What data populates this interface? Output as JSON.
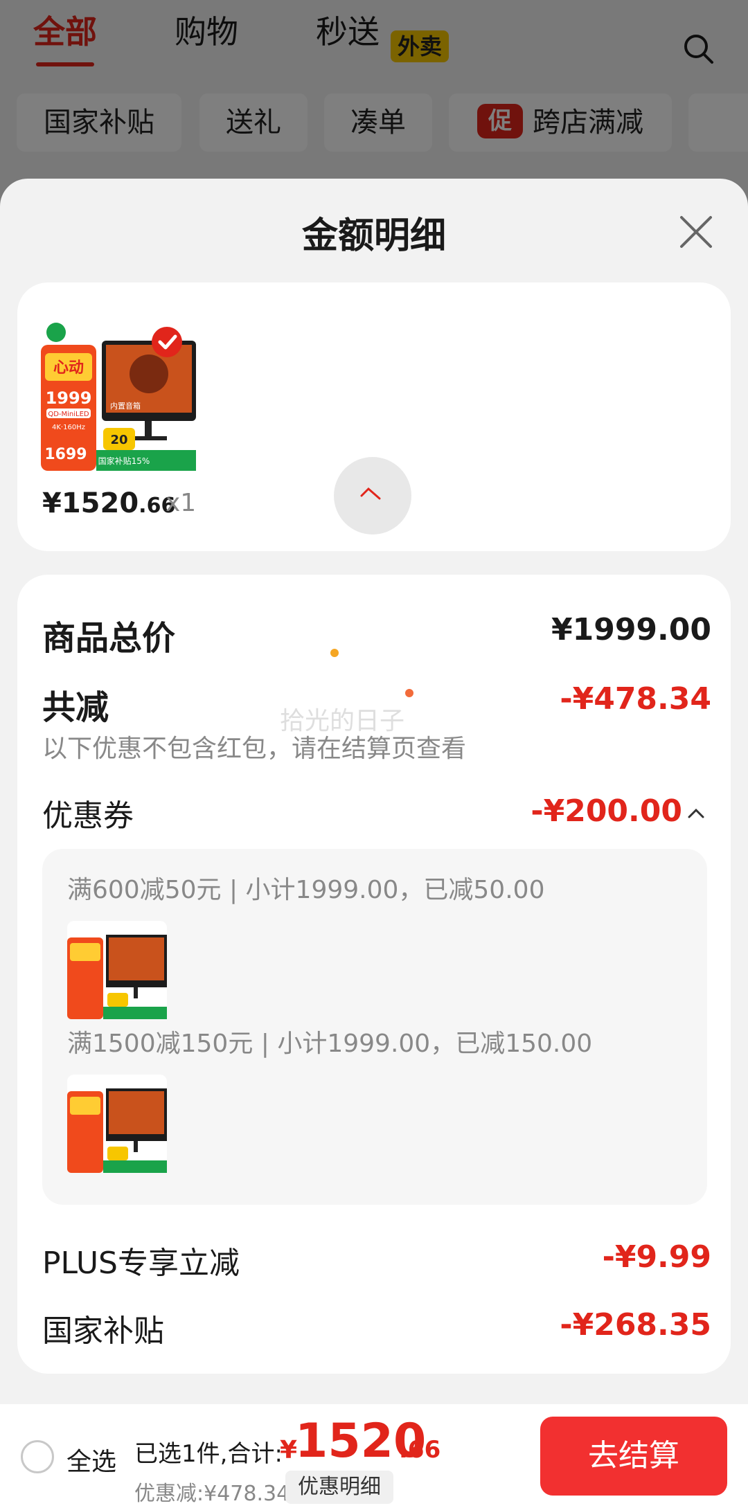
{
  "top_tabs": {
    "all": "全部",
    "shopping": "购物",
    "flash": "秒送",
    "takeout_badge": "外卖"
  },
  "chips": {
    "national_subsidy": "国家补贴",
    "gift": "送礼",
    "bundle": "凑单",
    "promo_tag": "促",
    "cross_store": "跨店满减"
  },
  "sheet": {
    "title": "金额明细"
  },
  "product": {
    "price_int": "¥1520",
    "price_dec": ".66",
    "qty": "x1"
  },
  "detail": {
    "total_label": "商品总价",
    "total_value": "¥1999.00",
    "reduce_label": "共减",
    "reduce_value": "-¥478.34",
    "note": "以下优惠不包含红包，请在结算页查看",
    "coupon_label": "优惠券",
    "coupon_value": "-¥200.00",
    "coupon_lines": [
      "满600减50元 | 小计1999.00，已减50.00",
      "满1500减150元 | 小计1999.00，已减150.00"
    ],
    "plus_label": "PLUS专享立减",
    "plus_value": "-¥9.99",
    "subsidy_label": "国家补贴",
    "subsidy_value": "-¥268.35"
  },
  "watermark": "拾光的日子",
  "thumb_text": {
    "headline": "心动",
    "price": "1999",
    "price_tag": "1699",
    "spec1": "QD-MiniLED",
    "spec2": "4K·160Hz",
    "badge": "20",
    "subsidy": "国家补贴15%",
    "screen_text": "内置音箱"
  },
  "bottom_bar": {
    "select_all": "全选",
    "total_prefix": "已选1件,合计:",
    "currency": "¥",
    "total_int": "1520",
    "total_dec": ".66",
    "discount_note": "优惠减:¥478.34",
    "detail_button": "优惠明细",
    "checkout_button": "去结算"
  },
  "colors": {
    "accent_red": "#e1251b",
    "checkout_red": "#f23030",
    "takeout_yellow": "#f7c600"
  }
}
